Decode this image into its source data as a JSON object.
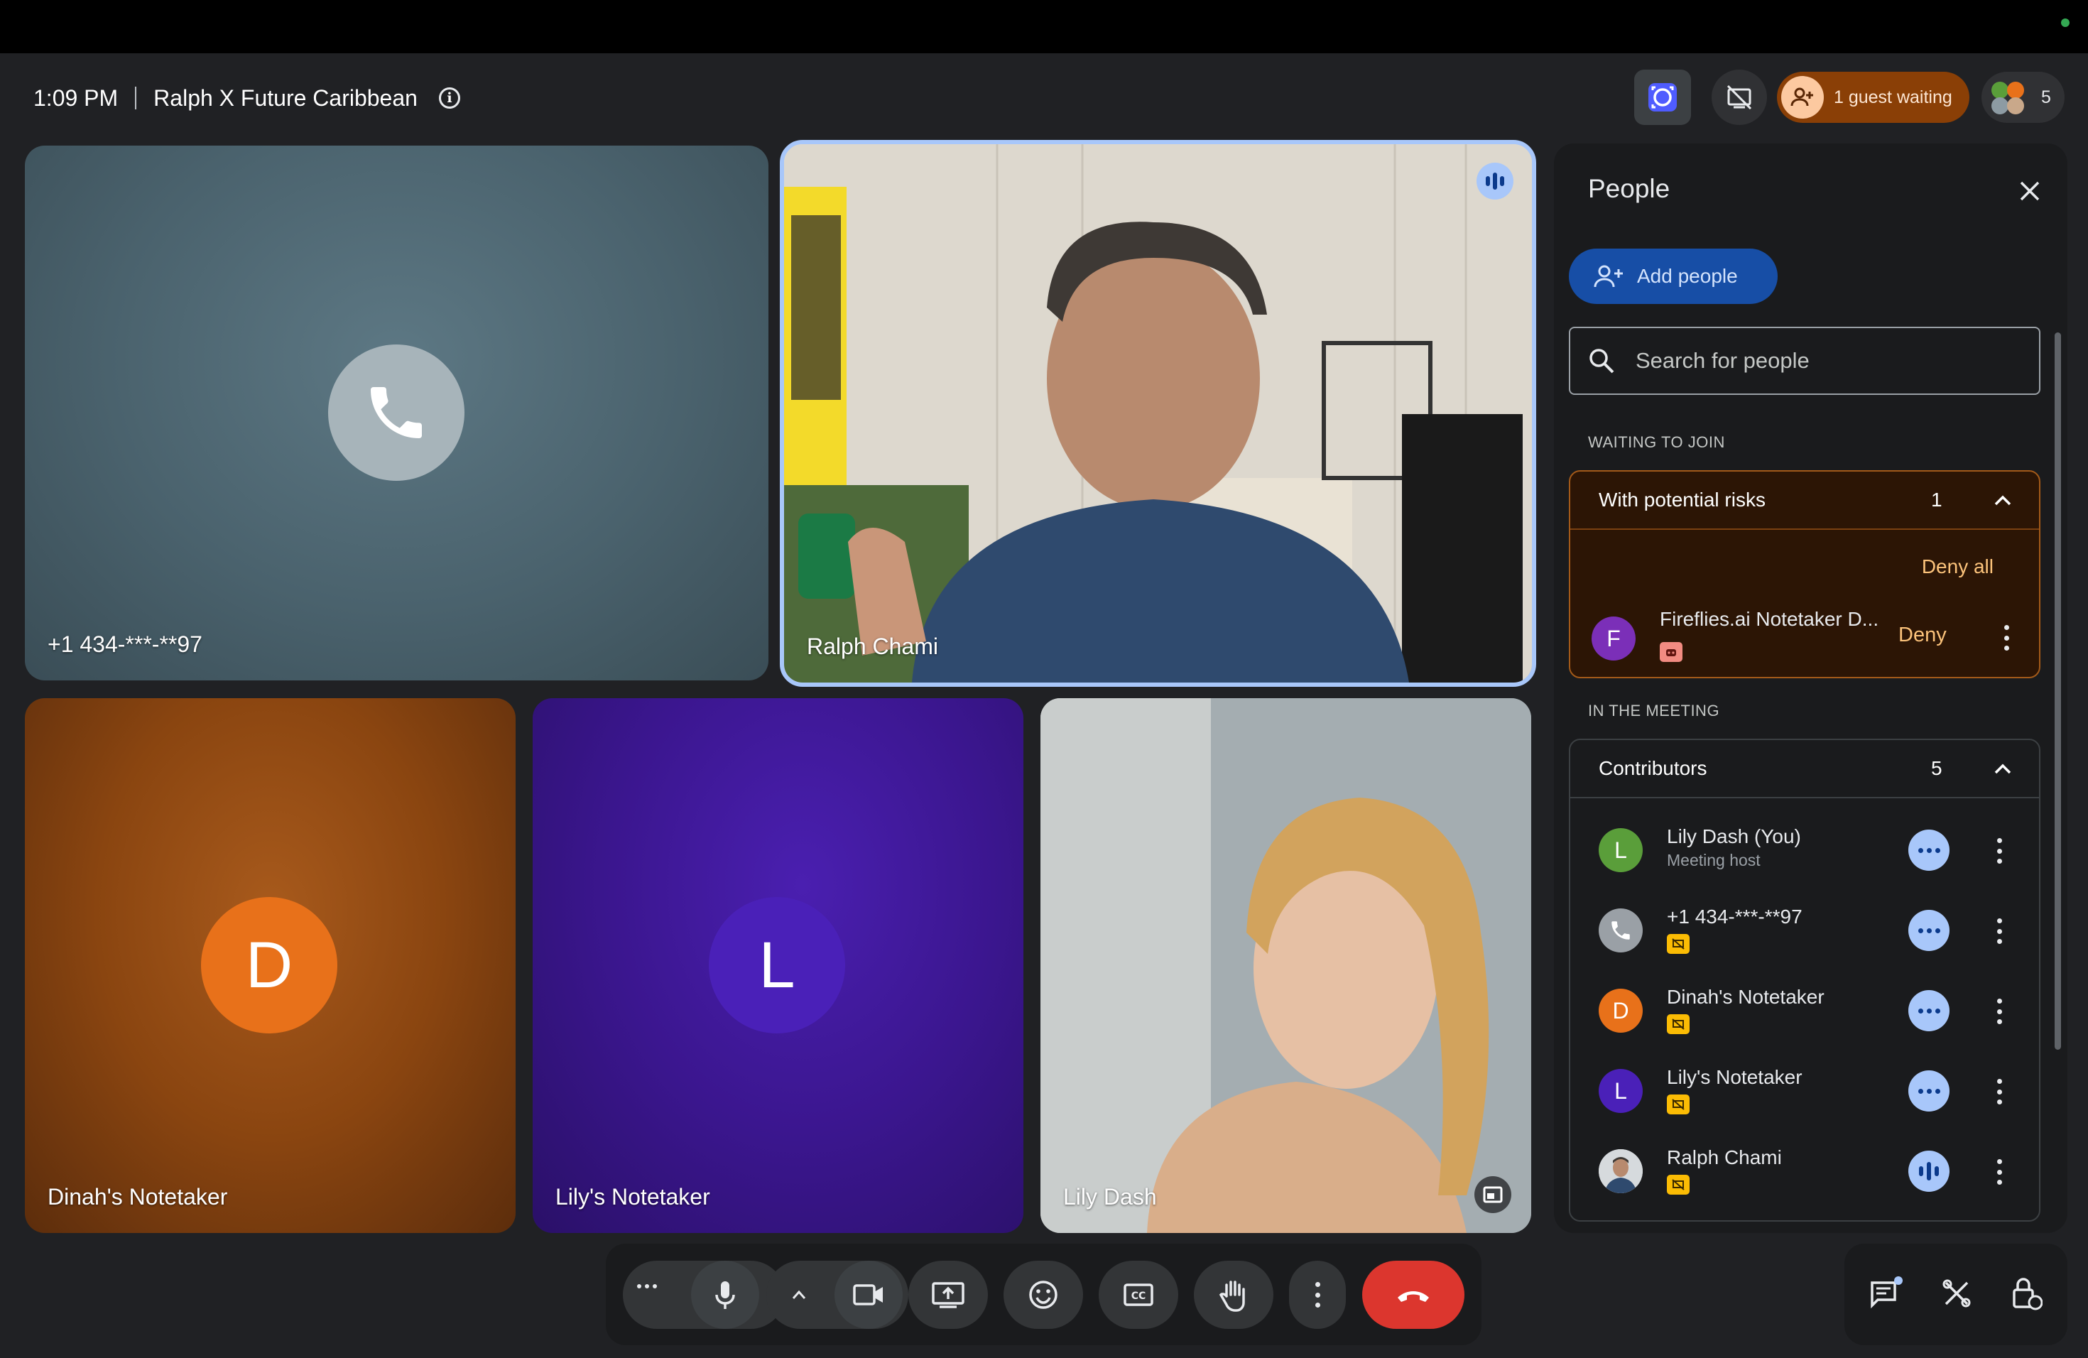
{
  "header": {
    "time": "1:09 PM",
    "meeting_title": "Ralph X Future Caribbean",
    "guest_waiting_label": "1 guest waiting",
    "participant_count": "5"
  },
  "tiles": [
    {
      "name": "+1 434-***-**97",
      "kind": "phone",
      "color": "#a7b4ba"
    },
    {
      "name": "Ralph Chami",
      "kind": "video",
      "speaking": true
    },
    {
      "name": "Dinah's Notetaker",
      "kind": "avatar",
      "initial": "D",
      "color": "#e8711a"
    },
    {
      "name": "Lily's Notetaker",
      "kind": "avatar",
      "initial": "L",
      "color": "#4a20b8"
    },
    {
      "name": "Lily Dash",
      "kind": "video"
    }
  ],
  "people_panel": {
    "title": "People",
    "add_people_label": "Add people",
    "search_placeholder": "Search for people",
    "waiting_section": "WAITING TO JOIN",
    "risk_group": {
      "label": "With potential risks",
      "count": "1",
      "deny_all_label": "Deny all",
      "entries": [
        {
          "name": "Fireflies.ai Notetaker D...",
          "initial": "F",
          "color": "#7b2fb8",
          "deny_label": "Deny"
        }
      ]
    },
    "meeting_section": "IN THE MEETING",
    "contributors": {
      "label": "Contributors",
      "count": "5",
      "people": [
        {
          "name": "Lily Dash (You)",
          "sub": "Meeting host",
          "initial": "L",
          "color": "#5a9e3a"
        },
        {
          "name": "+1 434-***-**97",
          "sub": "",
          "initial": "",
          "color": "#9aa0a6",
          "icon": "phone-icon"
        },
        {
          "name": "Dinah's Notetaker",
          "sub": "",
          "initial": "D",
          "color": "#e8711a"
        },
        {
          "name": "Lily's Notetaker",
          "sub": "",
          "initial": "L",
          "color": "#4a20b8"
        },
        {
          "name": "Ralph Chami",
          "sub": "",
          "initial": "",
          "color": "#c8ccd0",
          "speaking": true
        }
      ]
    }
  },
  "controls": {
    "accent_end_call": "#dc362e",
    "icons": [
      "more-options-icon",
      "microphone-icon",
      "chevron-up-icon",
      "camera-icon",
      "present-screen-icon",
      "emoji-icon",
      "captions-icon",
      "raise-hand-icon",
      "more-vert-icon",
      "end-call-icon",
      "chat-icon",
      "activities-icon",
      "host-controls-icon"
    ]
  },
  "colors": {
    "background": "#202124",
    "panel": "#1a1b1d",
    "accent_blue": "#a8c7fa",
    "risk_orange": "#a35a19",
    "guest_pill": "#8a3f06"
  }
}
